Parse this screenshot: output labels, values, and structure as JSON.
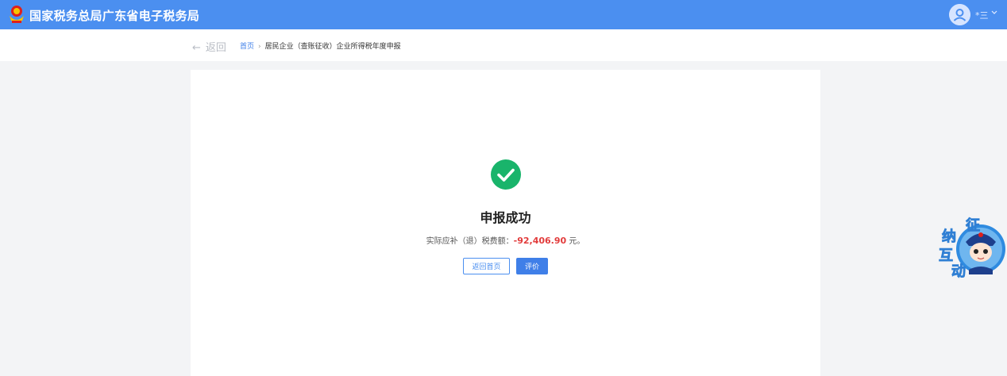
{
  "header": {
    "site_title": "国家税务总局广东省电子税务局",
    "user_name": "*三"
  },
  "nav": {
    "back_label": "返回",
    "breadcrumb": {
      "home": "首页",
      "separator": "›",
      "current": "居民企业（查账征收）企业所得税年度申报"
    }
  },
  "result": {
    "title": "申报成功",
    "amount_prefix": "实际应补（退）税费额：",
    "amount": "-92,406.90",
    "amount_suffix": "元。",
    "buttons": {
      "home": "返回首页",
      "rate": "评价"
    }
  },
  "widget": {
    "text_chars": [
      "征",
      "纳",
      "互",
      "动"
    ]
  },
  "colors": {
    "header_bg": "#4b8ff0",
    "success": "#19b46b",
    "amount": "#e23c3c",
    "primary_button": "#3f7fe8"
  }
}
